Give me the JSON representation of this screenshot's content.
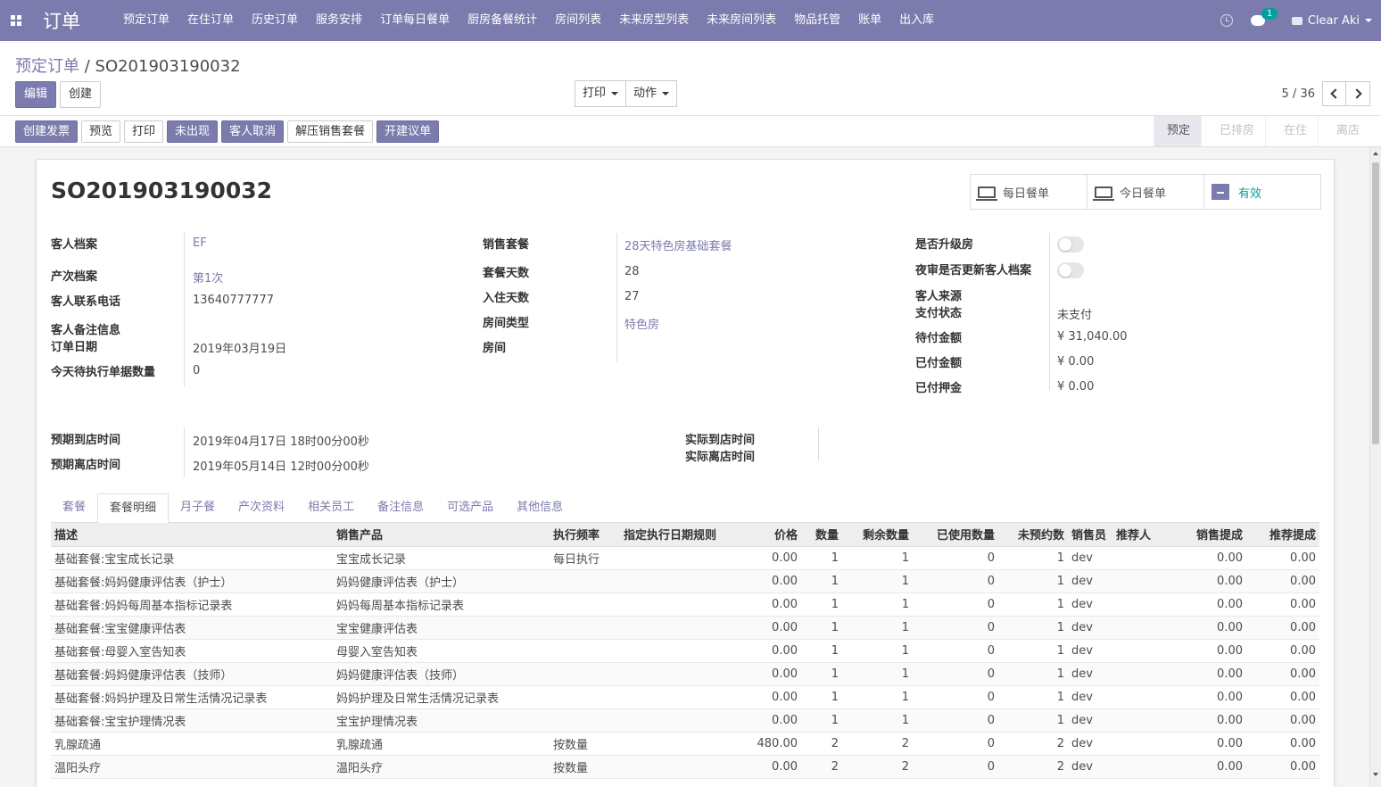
{
  "nav": {
    "brand": "订单",
    "menu": [
      "预定订单",
      "在住订单",
      "历史订单",
      "服务安排",
      "订单每日餐单",
      "厨房备餐统计",
      "房间列表",
      "未来房型列表",
      "未来房间列表",
      "物品托管",
      "账单",
      "出入库"
    ],
    "chat_count": "1",
    "user": "Clear Aki"
  },
  "breadcrumb": {
    "parent": "预定订单",
    "sep": " / ",
    "current": "SO201903190032"
  },
  "actions": {
    "edit": "编辑",
    "create": "创建",
    "print": "打印",
    "action": "动作"
  },
  "pager": {
    "value": "5 / 36"
  },
  "status_buttons": [
    "创建发票",
    "预览",
    "打印",
    "未出现",
    "客人取消",
    "解压销售套餐",
    "开建议单"
  ],
  "stages": [
    "预定",
    "已排房",
    "在住",
    "离店"
  ],
  "smart_buttons": {
    "daily_menu": "每日餐单",
    "today_menu": "今日餐单",
    "active": "有效"
  },
  "record": {
    "title": "SO201903190032",
    "left": [
      {
        "label": "客人档案",
        "value": "EF"
      },
      {
        "label": "产次档案",
        "value": "第1次"
      },
      {
        "label": "客人联系电话",
        "value": "13640777777"
      },
      {
        "label": "客人备注信息",
        "value": ""
      },
      {
        "label": "订单日期",
        "value": "2019年03月19日"
      },
      {
        "label": "今天待执行单据数量",
        "value": "0"
      }
    ],
    "middle": [
      {
        "label": "销售套餐",
        "value": "28天特色房基础套餐"
      },
      {
        "label": "套餐天数",
        "value": "28"
      },
      {
        "label": "入住天数",
        "value": "27"
      },
      {
        "label": "房间类型",
        "value": "特色房"
      },
      {
        "label": "房间",
        "value": ""
      }
    ],
    "right": [
      {
        "label": "是否升级房",
        "value": ""
      },
      {
        "label": "夜审是否更新客人档案",
        "value": ""
      },
      {
        "label": "客人来源",
        "value": ""
      },
      {
        "label": "支付状态",
        "value": "未支付"
      },
      {
        "label": "待付金额",
        "value": "¥ 31,040.00"
      },
      {
        "label": "已付金额",
        "value": "¥ 0.00"
      },
      {
        "label": "已付押金",
        "value": "¥ 0.00"
      }
    ],
    "times_left": [
      {
        "label": "预期到店时间",
        "value": "2019年04月17日 18时00分00秒"
      },
      {
        "label": "预期离店时间",
        "value": "2019年05月14日 12时00分00秒"
      }
    ],
    "times_right": [
      {
        "label": "实际到店时间",
        "value": ""
      },
      {
        "label": "实际离店时间",
        "value": ""
      }
    ]
  },
  "tabs": [
    "套餐",
    "套餐明细",
    "月子餐",
    "产次资料",
    "相关员工",
    "备注信息",
    "可选产品",
    "其他信息"
  ],
  "table": {
    "columns": [
      "描述",
      "销售产品",
      "执行频率",
      "指定执行日期规则",
      "价格",
      "数量",
      "剩余数量",
      "已使用数量",
      "未预约数",
      "销售员",
      "推荐人",
      "销售提成",
      "推荐提成"
    ],
    "rows": [
      [
        "基础套餐:宝宝成长记录",
        "宝宝成长记录",
        "每日执行",
        "",
        "0.00",
        "1",
        "1",
        "0",
        "1",
        "dev",
        "",
        "0.00",
        "0.00"
      ],
      [
        "基础套餐:妈妈健康评估表（护士）",
        "妈妈健康评估表（护士）",
        "",
        "",
        "0.00",
        "1",
        "1",
        "0",
        "1",
        "dev",
        "",
        "0.00",
        "0.00"
      ],
      [
        "基础套餐:妈妈每周基本指标记录表",
        "妈妈每周基本指标记录表",
        "",
        "",
        "0.00",
        "1",
        "1",
        "0",
        "1",
        "dev",
        "",
        "0.00",
        "0.00"
      ],
      [
        "基础套餐:宝宝健康评估表",
        "宝宝健康评估表",
        "",
        "",
        "0.00",
        "1",
        "1",
        "0",
        "1",
        "dev",
        "",
        "0.00",
        "0.00"
      ],
      [
        "基础套餐:母婴入室告知表",
        "母婴入室告知表",
        "",
        "",
        "0.00",
        "1",
        "1",
        "0",
        "1",
        "dev",
        "",
        "0.00",
        "0.00"
      ],
      [
        "基础套餐:妈妈健康评估表（技师）",
        "妈妈健康评估表（技师）",
        "",
        "",
        "0.00",
        "1",
        "1",
        "0",
        "1",
        "dev",
        "",
        "0.00",
        "0.00"
      ],
      [
        "基础套餐:妈妈护理及日常生活情况记录表",
        "妈妈护理及日常生活情况记录表",
        "",
        "",
        "0.00",
        "1",
        "1",
        "0",
        "1",
        "dev",
        "",
        "0.00",
        "0.00"
      ],
      [
        "基础套餐:宝宝护理情况表",
        "宝宝护理情况表",
        "",
        "",
        "0.00",
        "1",
        "1",
        "0",
        "1",
        "dev",
        "",
        "0.00",
        "0.00"
      ],
      [
        "乳腺疏通",
        "乳腺疏通",
        "按数量",
        "",
        "480.00",
        "2",
        "2",
        "0",
        "2",
        "dev",
        "",
        "0.00",
        "0.00"
      ],
      [
        "温阳头疗",
        "温阳头疗",
        "按数量",
        "",
        "0.00",
        "2",
        "2",
        "0",
        "2",
        "dev",
        "",
        "0.00",
        "0.00"
      ]
    ]
  }
}
